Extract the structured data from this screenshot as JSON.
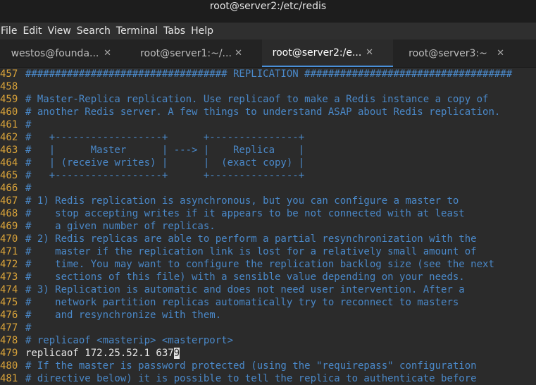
{
  "window": {
    "title": "root@server2:/etc/redis"
  },
  "menu": [
    "File",
    "Edit",
    "View",
    "Search",
    "Terminal",
    "Tabs",
    "Help"
  ],
  "tabs": [
    {
      "label": "westos@founda...",
      "active": false
    },
    {
      "label": "root@server1:~/...",
      "active": false
    },
    {
      "label": "root@server2:/e...",
      "active": true
    },
    {
      "label": "root@server3:~",
      "active": false
    }
  ],
  "close_glyph": "✕",
  "lines": [
    {
      "n": "457",
      "t": "################################## REPLICATION ###################################",
      "k": "cmt"
    },
    {
      "n": "458",
      "t": "",
      "k": "cmt"
    },
    {
      "n": "459",
      "t": "# Master-Replica replication. Use replicaof to make a Redis instance a copy of",
      "k": "cmt"
    },
    {
      "n": "460",
      "t": "# another Redis server. A few things to understand ASAP about Redis replication.",
      "k": "cmt"
    },
    {
      "n": "461",
      "t": "#",
      "k": "cmt"
    },
    {
      "n": "462",
      "t": "#   +------------------+      +---------------+",
      "k": "cmt"
    },
    {
      "n": "463",
      "t": "#   |      Master      | ---> |    Replica    |",
      "k": "cmt"
    },
    {
      "n": "464",
      "t": "#   | (receive writes) |      |  (exact copy) |",
      "k": "cmt"
    },
    {
      "n": "465",
      "t": "#   +------------------+      +---------------+",
      "k": "cmt"
    },
    {
      "n": "466",
      "t": "#",
      "k": "cmt"
    },
    {
      "n": "467",
      "t": "# 1) Redis replication is asynchronous, but you can configure a master to",
      "k": "cmt"
    },
    {
      "n": "468",
      "t": "#    stop accepting writes if it appears to be not connected with at least",
      "k": "cmt"
    },
    {
      "n": "469",
      "t": "#    a given number of replicas.",
      "k": "cmt"
    },
    {
      "n": "470",
      "t": "# 2) Redis replicas are able to perform a partial resynchronization with the",
      "k": "cmt"
    },
    {
      "n": "471",
      "t": "#    master if the replication link is lost for a relatively small amount of",
      "k": "cmt"
    },
    {
      "n": "472",
      "t": "#    time. You may want to configure the replication backlog size (see the next",
      "k": "cmt"
    },
    {
      "n": "473",
      "t": "#    sections of this file) with a sensible value depending on your needs.",
      "k": "cmt"
    },
    {
      "n": "474",
      "t": "# 3) Replication is automatic and does not need user intervention. After a",
      "k": "cmt"
    },
    {
      "n": "475",
      "t": "#    network partition replicas automatically try to reconnect to masters",
      "k": "cmt"
    },
    {
      "n": "476",
      "t": "#    and resynchronize with them.",
      "k": "cmt"
    },
    {
      "n": "477",
      "t": "#",
      "k": "cmt"
    },
    {
      "n": "478",
      "t": "# replicaof <masterip> <masterport>",
      "k": "cmt"
    },
    {
      "n": "479",
      "t": "replicaof 172.25.52.1 637",
      "k": "code",
      "cursor": "9"
    },
    {
      "n": "480",
      "t": "# If the master is password protected (using the \"requirepass\" configuration",
      "k": "cmt"
    },
    {
      "n": "481",
      "t": "# directive below) it is possible to tell the replica to authenticate before",
      "k": "cmt"
    }
  ],
  "colors": {
    "line_number": "#d9a33a",
    "comment": "#4a88c8",
    "text": "#e6e6e6",
    "background": "#2b2b2b",
    "active_tab_underline": "#4a90d9"
  }
}
